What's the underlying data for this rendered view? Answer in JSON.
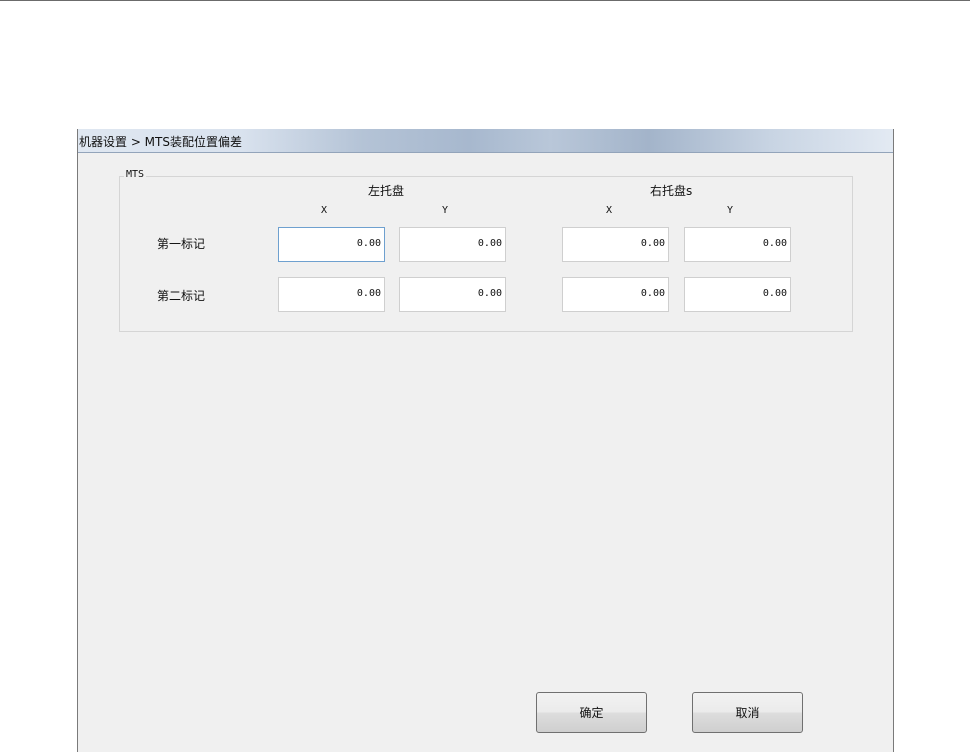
{
  "window": {
    "title": "机器设置 > MTS装配位置偏差"
  },
  "group": {
    "label": "MTS",
    "left_tray": {
      "title": "左托盘",
      "col_x": "X",
      "col_y": "Y"
    },
    "right_tray": {
      "title": "右托盘s",
      "col_x": "X",
      "col_y": "Y"
    },
    "rows": [
      {
        "label": "第一标记",
        "left_x": "0.00",
        "left_y": "0.00",
        "right_x": "0.00",
        "right_y": "0.00"
      },
      {
        "label": "第二标记",
        "left_x": "0.00",
        "left_y": "0.00",
        "right_x": "0.00",
        "right_y": "0.00"
      }
    ]
  },
  "buttons": {
    "ok": "确定",
    "cancel": "取消"
  }
}
